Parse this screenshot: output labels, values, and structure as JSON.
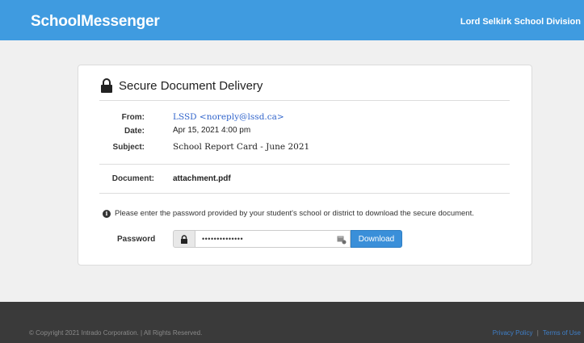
{
  "header": {
    "brand": "SchoolMessenger",
    "organization": "Lord Selkirk School Division",
    "color": "#3f9be0"
  },
  "card": {
    "title": "Secure Document Delivery",
    "title_icon": "lock-icon",
    "from_label": "From:",
    "from_value": "LSSD <noreply@lssd.ca>",
    "date_label": "Date:",
    "date_value": "Apr 15, 2021 4:00 pm",
    "subject_label": "Subject:",
    "subject_value": "School Report Card - June 2021",
    "document_label": "Document:",
    "document_value": "attachment.pdf",
    "info_text": "Please enter the password provided by your student's school or district to download the secure document.",
    "info_icon": "info-icon",
    "password_label": "Password",
    "password_value": "••••••••••••••",
    "download_label": "Download",
    "accent": "#3a8fd9"
  },
  "footer": {
    "copyright": "© Copyright 2021 Intrado Corporation.  |  All Rights Reserved.",
    "privacy": "Privacy Policy",
    "separator": "|",
    "terms": "Terms of Use",
    "background": "#3a3a3a"
  }
}
